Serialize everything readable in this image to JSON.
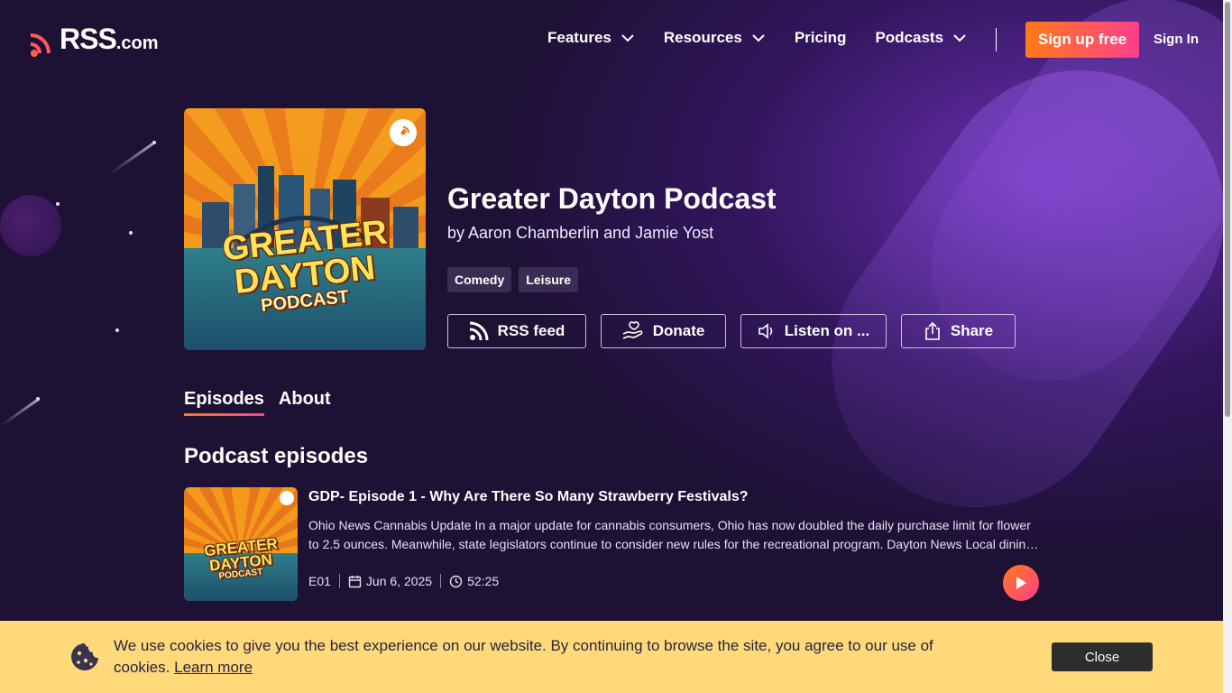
{
  "header": {
    "logo_text": "RSS",
    "logo_suffix": ".com",
    "nav": [
      {
        "label": "Features",
        "has_dropdown": true
      },
      {
        "label": "Resources",
        "has_dropdown": true
      },
      {
        "label": "Pricing",
        "has_dropdown": false
      },
      {
        "label": "Podcasts",
        "has_dropdown": true
      }
    ],
    "signup_label": "Sign up free",
    "signin_label": "Sign In"
  },
  "podcast": {
    "cover_title_line1": "GREATER",
    "cover_title_line2": "DAYTON",
    "cover_title_line3": "PODCAST",
    "title": "Greater Dayton Podcast",
    "author": "by Aaron Chamberlin and Jamie Yost",
    "tags": [
      "Comedy",
      "Leisure"
    ],
    "actions": {
      "rss": "RSS feed",
      "donate": "Donate",
      "listen": "Listen on ...",
      "share": "Share"
    }
  },
  "tabs": {
    "episodes": "Episodes",
    "about": "About",
    "active": "Episodes"
  },
  "episodes_section": {
    "title": "Podcast episodes",
    "items": [
      {
        "title": "GDP- Episode 1 - Why Are There So Many Strawberry Festivals?",
        "description": "Ohio News Cannabis Update In a major update for cannabis consumers, Ohio has now doubled the daily purchase limit for flower to 2.5 ounces. Meanwhile, state legislators continue to consider new rules for the recreational program. Dayton News Local dining and events round out the week with a look at the summer festival calendar.",
        "number": "E01",
        "date": "Jun 6, 2025",
        "duration": "52:25"
      }
    ]
  },
  "cookie_banner": {
    "text": "We use cookies to give you the best experience on our website. By continuing to browse the site, you agree to our use of cookies.",
    "link_label": "Learn more",
    "close_label": "Close"
  },
  "colors": {
    "background": "#1d1134",
    "accent_start": "#ff7a18",
    "accent_end": "#ff3f8b",
    "cookie_bg": "#ffd97a",
    "tag_bg": "#3a2d52"
  }
}
